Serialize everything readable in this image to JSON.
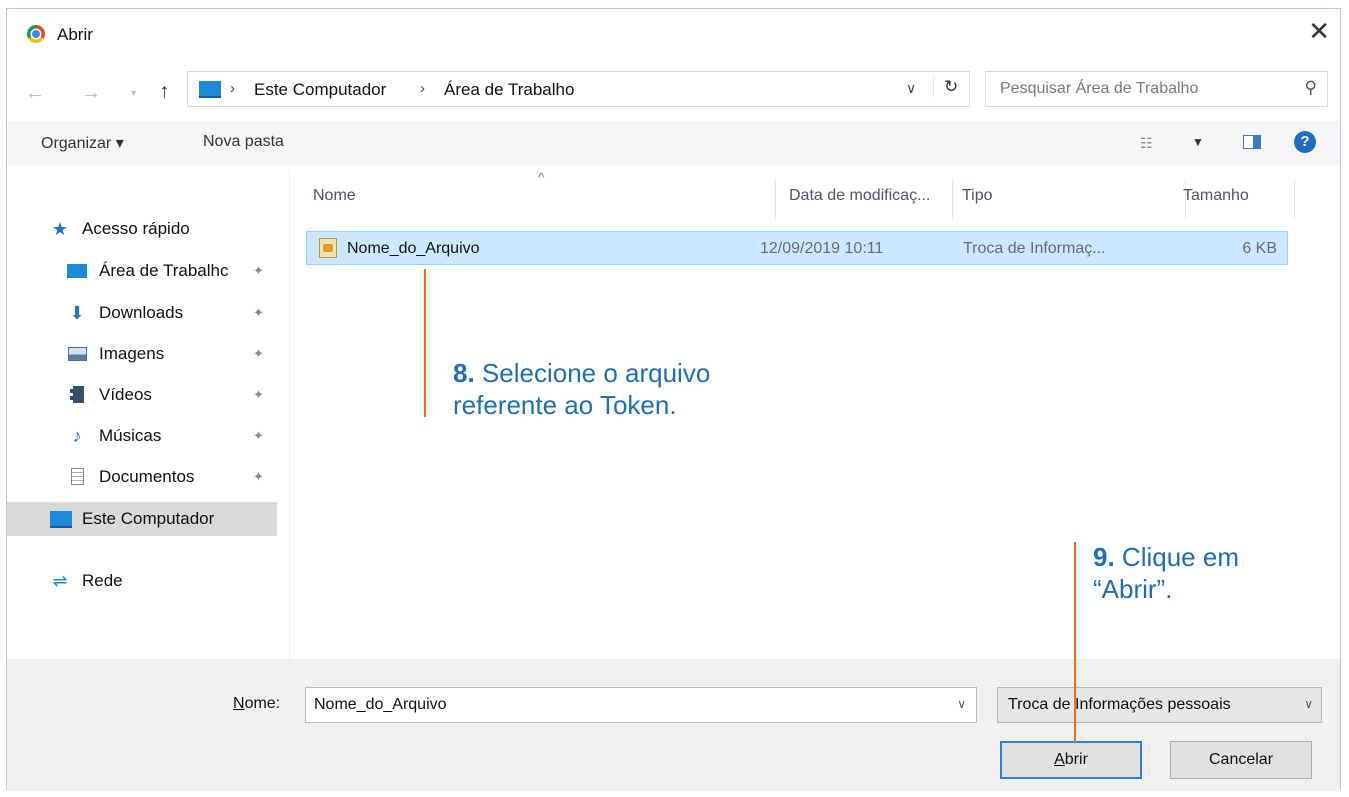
{
  "window": {
    "title": "Abrir"
  },
  "address": {
    "crumbs": [
      "Este Computador",
      "Área de Trabalho"
    ],
    "search_placeholder": "Pesquisar Área de Trabalho"
  },
  "toolbar": {
    "organize": "Organizar ▾",
    "new_folder": "Nova pasta"
  },
  "nav": {
    "items": [
      {
        "label": "Acesso rápido",
        "icon": "star-icon"
      },
      {
        "label": "Área de Trabalhc",
        "icon": "desktop-icon",
        "pinned": true
      },
      {
        "label": "Downloads",
        "icon": "download-arrow-icon",
        "pinned": true
      },
      {
        "label": "Imagens",
        "icon": "pictures-icon",
        "pinned": true
      },
      {
        "label": "Vídeos",
        "icon": "film-icon",
        "pinned": true
      },
      {
        "label": "Músicas",
        "icon": "music-note-icon",
        "pinned": true
      },
      {
        "label": "Documentos",
        "icon": "document-icon",
        "pinned": true
      },
      {
        "label": "Este Computador",
        "icon": "computer-icon",
        "selected": true
      },
      {
        "label": "Rede",
        "icon": "network-icon"
      }
    ]
  },
  "columns": [
    "Nome",
    "Data de modificaç...",
    "Tipo",
    "Tamanho"
  ],
  "files": [
    {
      "name": "Nome_do_Arquivo",
      "date": "12/09/2019 10:11",
      "type": "Troca de Informaç...",
      "size": "6 KB"
    }
  ],
  "annotations": {
    "step8_num": "8.",
    "step8_line1": "Selecione o arquivo",
    "step8_line2": "referente ao Token.",
    "step9_num": "9.",
    "step9_line1": "Clique em",
    "step9_line2": "“Abrir”."
  },
  "bottom": {
    "name_label_underlined": "N",
    "name_label_rest": "ome:",
    "name_value": "Nome_do_Arquivo",
    "type_value": "Troca de Informações pessoais",
    "open_button_underlined": "A",
    "open_button_rest": "brir",
    "cancel_button": "Cancelar"
  },
  "colors": {
    "accent": "#1c6fb6",
    "annotation_line": "#e96f1e",
    "selection": "#cce8ff"
  }
}
